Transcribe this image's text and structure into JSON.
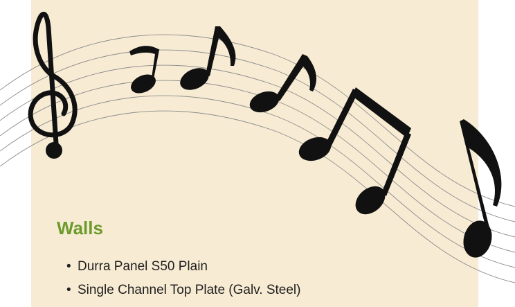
{
  "section": {
    "heading": "Walls",
    "items": [
      "Durra Panel S50 Plain",
      "Single Channel Top Plate (Galv. Steel)"
    ]
  },
  "colors": {
    "panel_background": "#f7ebd3",
    "heading": "#6c9a2c",
    "notes": "#111111",
    "staff_lines": "#8c8c8c"
  },
  "decoration": {
    "icons": [
      "treble-clef-icon",
      "music-note-icon",
      "beamed-notes-icon"
    ]
  }
}
